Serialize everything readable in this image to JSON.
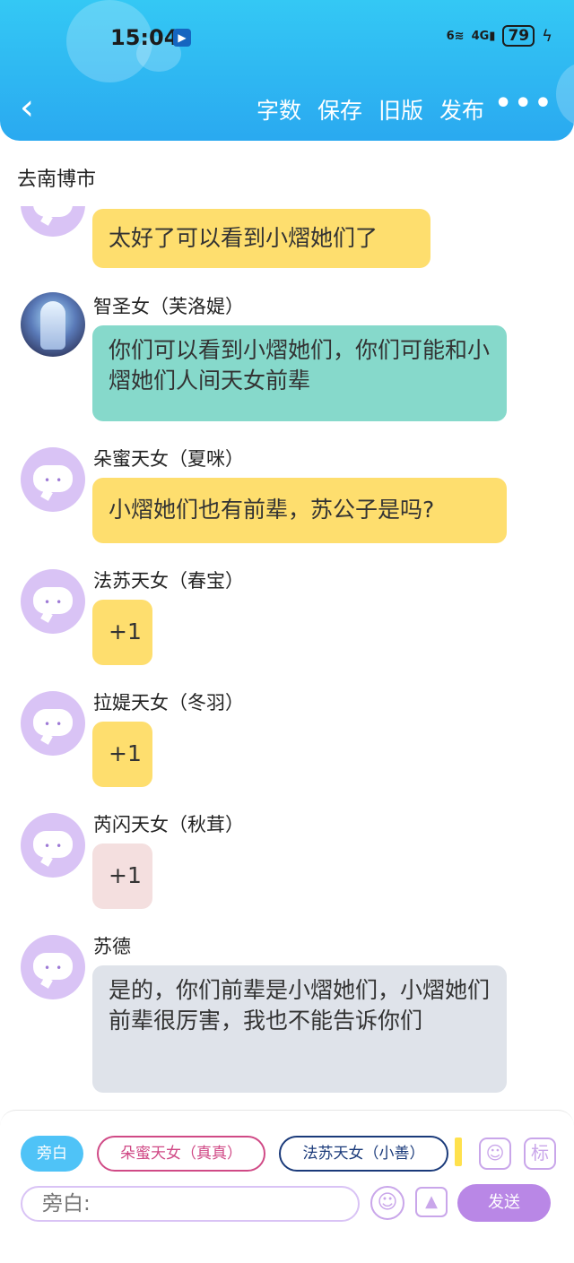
{
  "status_bar": {
    "time": "15:04",
    "signal_text": "4G",
    "wifi_label": "6",
    "battery": "79"
  },
  "nav": {
    "actions": [
      "字数",
      "保存",
      "旧版",
      "发布"
    ],
    "more": "•••"
  },
  "scene_title": "去南博市",
  "messages": [
    {
      "name": "",
      "text": "太好了可以看到小熠她们了",
      "color": "yellow"
    },
    {
      "name": "智圣女（芙洛媞）",
      "text": "你们可以看到小熠她们，你们可能和小熠她们人间天女前辈",
      "color": "teal"
    },
    {
      "name": "朵蜜天女（夏咪）",
      "text": "小熠她们也有前辈，苏公子是吗?",
      "color": "yellow"
    },
    {
      "name": "法苏天女（春宝）",
      "text": "+1",
      "color": "yellow"
    },
    {
      "name": "拉媞天女（冬羽）",
      "text": "+1",
      "color": "yellow"
    },
    {
      "name": "芮闪天女（秋茸）",
      "text": "+1",
      "color": "pink"
    },
    {
      "name": "苏德",
      "text": "是的，你们前辈是小熠她们，小熠她们前辈很厉害，我也不能告诉你们",
      "color": "grey"
    }
  ],
  "bottom_bar": {
    "roles": [
      "旁白",
      "朵蜜天女（真真）",
      "法苏天女（小善）"
    ],
    "input_placeholder": "旁白:",
    "send_label": "发送",
    "tag_label": "标"
  },
  "colors": {
    "header": "#2aa9f0",
    "bubble_yellow": "#fede6e",
    "bubble_teal": "#86d9cb",
    "bubble_pink": "#f4dfdf",
    "bubble_grey": "#dfe3ea",
    "accent_purple": "#b987e6"
  }
}
